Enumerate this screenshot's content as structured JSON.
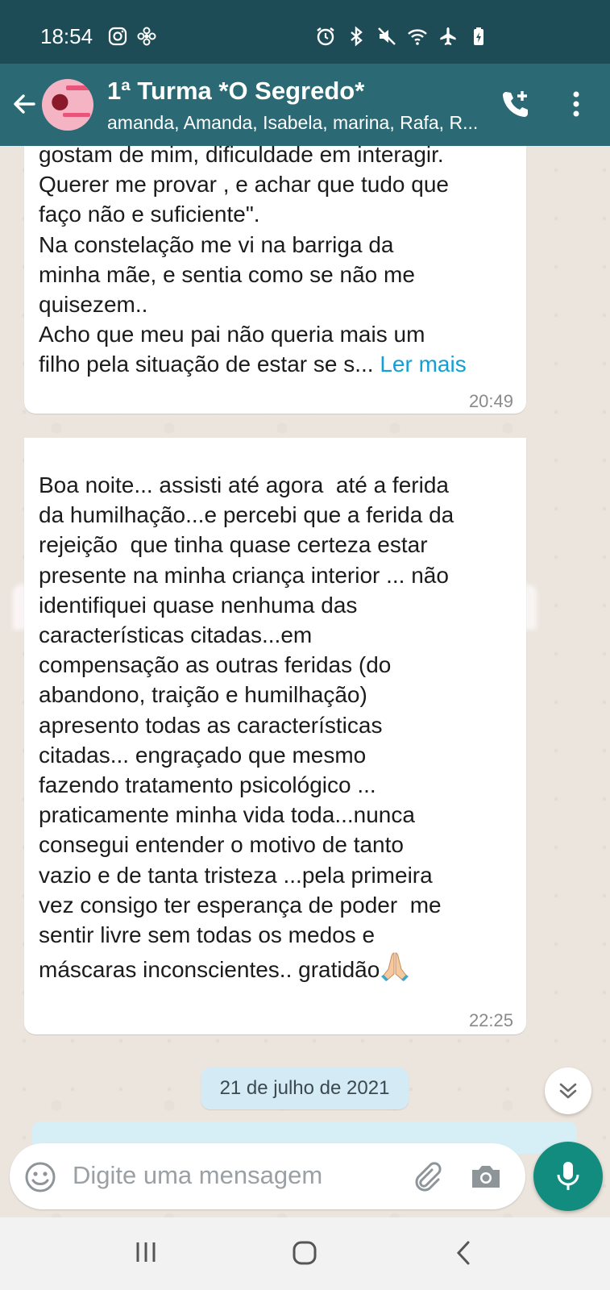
{
  "status_bar": {
    "time": "18:54",
    "left_icons": [
      "instagram-icon",
      "fan-icon"
    ],
    "right_icons": [
      "alarm-icon",
      "bluetooth-icon",
      "mute-icon",
      "wifi-icon",
      "airplane-icon",
      "battery-icon"
    ]
  },
  "header": {
    "title": "1ª Turma *O Segredo*",
    "members": "amanda, Amanda, Isabela, marina, Rafa, R...",
    "icons": [
      "back-arrow-icon",
      "group-avatar",
      "add-call-icon",
      "more-vert-icon"
    ]
  },
  "messages": [
    {
      "text_lines": [
        "gostam de mim, dificuldade em interagir.",
        "Querer me provar , e achar que tudo que",
        "faço não e suficiente\".",
        "Na constelação me vi na barriga da",
        "minha mãe, e sentia como se não me",
        "quisezem..",
        "Acho que meu pai não queria mais um",
        "filho pela situação de estar se s..."
      ],
      "read_more": "Ler mais",
      "time": "20:49"
    },
    {
      "text_lines": [
        "Boa noite... assisti até agora  até a ferida",
        "da humilhação...e percebi que a ferida da",
        "rejeição  que tinha quase certeza estar",
        "presente na minha criança interior ... não",
        "identifiquei quase nenhuma das",
        "características citadas...em",
        "compensação as outras feridas (do",
        "abandono, traição e humilhação)",
        "apresento todas as características",
        "citadas... engraçado que mesmo",
        "fazendo tratamento psicológico ...",
        "praticamente minha vida toda...nunca",
        "consegui entender o motivo de tanto",
        "vazio e de tanta tristeza ...pela primeira",
        "vez consigo ter esperança de poder  me",
        "sentir livre sem todas os medos e",
        "máscaras inconscientes.. gratidão"
      ],
      "emoji": "folded-hands-emoji",
      "time": "22:25"
    }
  ],
  "date_chip": "21 de julho de 2021",
  "input": {
    "placeholder": "Digite uma mensagem",
    "icons": [
      "emoji-icon",
      "attach-icon",
      "camera-icon",
      "mic-icon"
    ]
  },
  "nav_bar": {
    "icons": [
      "recent-apps-icon",
      "home-icon",
      "back-icon"
    ]
  },
  "colors": {
    "status_bar": "#1e4c56",
    "header": "#2b6a74",
    "chat_bg": "#ece5dd",
    "bubble": "#ffffff",
    "link": "#129fd3",
    "mic_button": "#128c7e",
    "date_chip": "#d4eaf4"
  }
}
